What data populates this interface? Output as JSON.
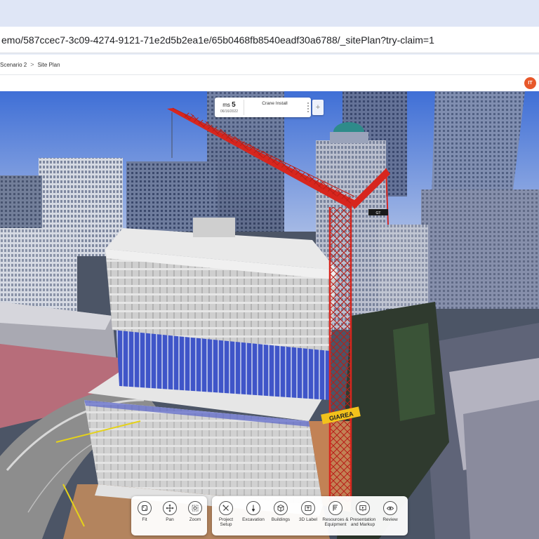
{
  "browser": {
    "url": "emo/587ccec7-3c09-4274-9121-71e2d5b2ea1e/65b0468fb8540eadf30a6788/_sitePlan?try-claim=1"
  },
  "breadcrumb": {
    "parent": "Scenario 2",
    "separator": ">",
    "current": "Site Plan"
  },
  "user": {
    "initials": "IT",
    "avatar_color": "#e8582a"
  },
  "milestone": {
    "prefix": "ms",
    "number": "5",
    "date": "06/16/2022",
    "title": "Crane Install",
    "add_label": "+"
  },
  "scene": {
    "crane_label": "GT",
    "area_sign": "GIAREA",
    "crane_color": "#d7261e"
  },
  "toolbar_view": [
    {
      "label": "Fit",
      "icon": "fit-icon"
    },
    {
      "label": "Pan",
      "icon": "pan-icon"
    },
    {
      "label": "Zoom",
      "icon": "zoom-icon"
    }
  ],
  "toolbar_main": [
    {
      "label": "Project\nSetup",
      "icon": "project-setup-icon"
    },
    {
      "label": "Excavation",
      "icon": "excavation-icon"
    },
    {
      "label": "Buildings",
      "icon": "buildings-icon"
    },
    {
      "label": "3D Label",
      "icon": "3d-label-icon"
    },
    {
      "label": "Resources &\nEquipment",
      "icon": "resources-icon"
    },
    {
      "label": "Presentation\nand Markup",
      "icon": "presentation-icon"
    },
    {
      "label": "Review",
      "icon": "review-icon"
    }
  ]
}
